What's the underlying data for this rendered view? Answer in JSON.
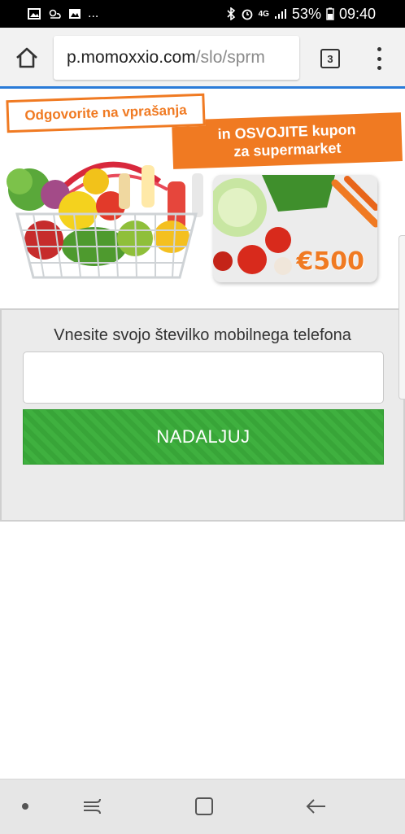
{
  "status_bar": {
    "left_icons": [
      "image-icon",
      "weather-icon",
      "gallery-icon"
    ],
    "overflow": "...",
    "network": "4G",
    "battery": "53%",
    "time": "09:40"
  },
  "browser": {
    "url_host": "p.momoxxio.com",
    "url_path": "/slo/sprm",
    "tab_count": "3"
  },
  "banner": {
    "tag1": "Odgovorite na vprašanja",
    "tag2_line1": "in OSVOJITE kupon",
    "tag2_line2": "za supermarket",
    "voucher_amount": "€500"
  },
  "form": {
    "label": "Vnesite svojo številko mobilnega telefona",
    "phone_value": "",
    "phone_placeholder": "",
    "button_label": "NADALJUJ"
  },
  "colors": {
    "accent_orange": "#f07a22",
    "button_green": "#3fb03f",
    "progress_blue": "#2a7bd8"
  }
}
